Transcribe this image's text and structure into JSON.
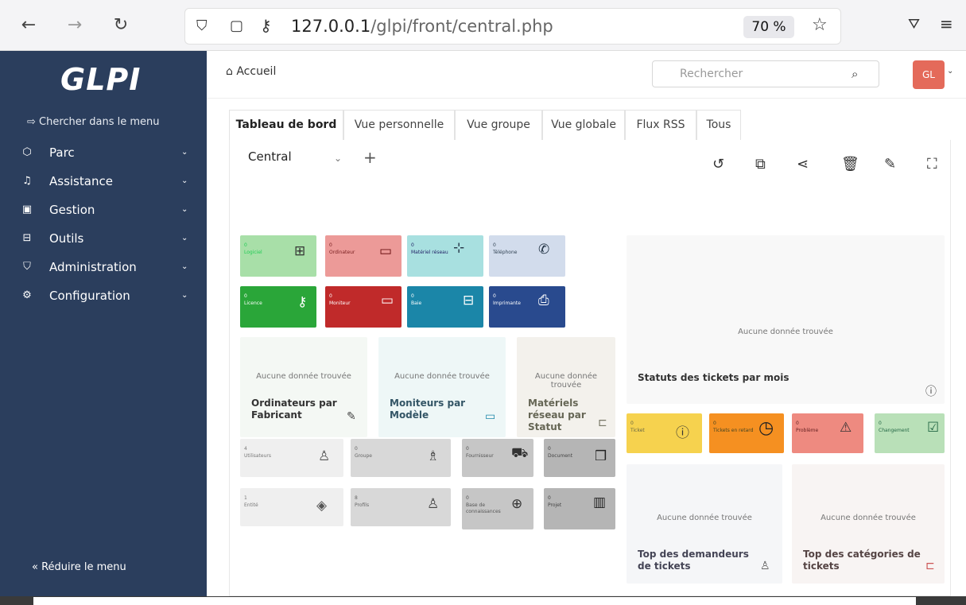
{
  "browser": {
    "url_host": "127.0.0.1",
    "url_path": "/glpi/front/central.php",
    "zoom": "70 %"
  },
  "sidebar": {
    "logo": "GLPI",
    "search_menu": "Chercher dans le menu",
    "items": [
      {
        "label": "Parc"
      },
      {
        "label": "Assistance"
      },
      {
        "label": "Gestion"
      },
      {
        "label": "Outils"
      },
      {
        "label": "Administration"
      },
      {
        "label": "Configuration"
      }
    ],
    "reduce": "Réduire le menu"
  },
  "header": {
    "breadcrumb": "Accueil",
    "search_placeholder": "Rechercher",
    "avatar": "GL"
  },
  "tabs": [
    {
      "label": "Tableau de bord"
    },
    {
      "label": "Vue personnelle"
    },
    {
      "label": "Vue groupe"
    },
    {
      "label": "Vue globale"
    },
    {
      "label": "Flux RSS"
    },
    {
      "label": "Tous"
    }
  ],
  "dashboard": {
    "selected": "Central",
    "add": "+"
  },
  "cards": [
    {
      "count": "0",
      "label": "Logiciel",
      "color": "#a8dfa8"
    },
    {
      "count": "0",
      "label": "Ordinateur",
      "color": "#ec9a98"
    },
    {
      "count": "0",
      "label": "Matériel réseau",
      "color": "#a8e0e0"
    },
    {
      "count": "0",
      "label": "Téléphone",
      "color": "#d2dcec"
    },
    {
      "count": "0",
      "label": "Licence",
      "color": "#2aa639"
    },
    {
      "count": "0",
      "label": "Moniteur",
      "color": "#c02a2a"
    },
    {
      "count": "0",
      "label": "Baie",
      "color": "#1b86a8"
    },
    {
      "count": "0",
      "label": "Imprimante",
      "color": "#294a8e"
    }
  ],
  "widgets": {
    "empty": "Aucune donnée trouvée",
    "ordi": "Ordinateurs par Fabricant",
    "moni": "Moniteurs par Modèle",
    "mat": "Matériels réseau par Statut",
    "stat": "Statuts des tickets par mois",
    "topdem": "Top des demandeurs de tickets",
    "topcat": "Top des catégories de tickets"
  },
  "tickets": [
    {
      "count": "0",
      "label": "Ticket",
      "color": "#f6d24e"
    },
    {
      "count": "0",
      "label": "Tickets en retard",
      "color": "#f59021"
    },
    {
      "count": "0",
      "label": "Problème",
      "color": "#ee8a80"
    },
    {
      "count": "0",
      "label": "Changement",
      "color": "#b9e0b8"
    }
  ],
  "small": [
    {
      "count": "4",
      "label": "Utilisateurs",
      "color": "#efefef"
    },
    {
      "count": "0",
      "label": "Groupe",
      "color": "#d8d8d8"
    },
    {
      "count": "0",
      "label": "Fournisseur",
      "color": "#c6c6c6"
    },
    {
      "count": "0",
      "label": "Document",
      "color": "#b5b5b5"
    },
    {
      "count": "1",
      "label": "Entité",
      "color": "#efefef"
    },
    {
      "count": "8",
      "label": "Profils",
      "color": "#d8d8d8"
    },
    {
      "count": "0",
      "label": "Base de connaissances",
      "color": "#c6c6c6"
    },
    {
      "count": "0",
      "label": "Projet",
      "color": "#b5b5b5"
    }
  ]
}
